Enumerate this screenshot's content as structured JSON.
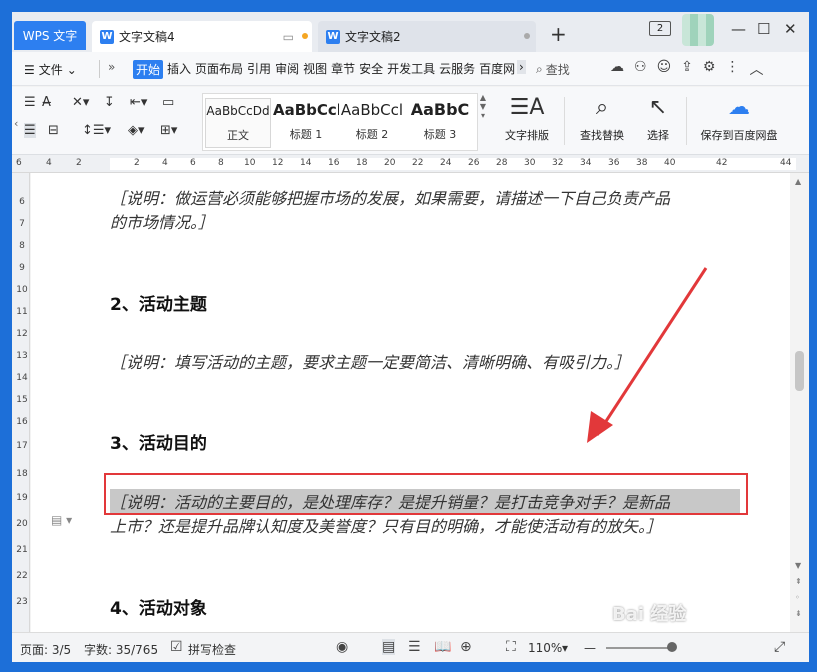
{
  "titlebar": {
    "app_tab": "WPS 文字",
    "tabs": [
      {
        "label": "文字文稿4",
        "active": true
      },
      {
        "label": "文字文稿2",
        "active": false
      }
    ],
    "window_count": "2"
  },
  "menubar": {
    "file_label": "文件",
    "more": "»",
    "items": [
      "开始",
      "插入",
      "页面布局",
      "引用",
      "审阅",
      "视图",
      "章节",
      "安全",
      "开发工具",
      "云服务",
      "百度网"
    ],
    "search_label": "查找"
  },
  "ribbon": {
    "styles": [
      {
        "preview": "AaBbCcDd",
        "name": "正文"
      },
      {
        "preview": "AaBbCcl",
        "name": "标题 1"
      },
      {
        "preview": "AaBbCcl",
        "name": "标题 2"
      },
      {
        "preview": "AaBbC",
        "name": "标题 3"
      }
    ],
    "text_layout": "文字排版",
    "find_replace": "查找替换",
    "select": "选择",
    "save_baidu": "保存到百度网盘"
  },
  "ruler": {
    "ticks": [
      "6",
      "4",
      "2",
      "",
      "2",
      "4",
      "6",
      "8",
      "10",
      "12",
      "14",
      "16",
      "18",
      "20",
      "22",
      "24",
      "26",
      "28",
      "30",
      "32",
      "34",
      "36",
      "38",
      "40",
      "42",
      "44"
    ]
  },
  "vruler": {
    "numbers": [
      "6",
      "7",
      "8",
      "9",
      "10",
      "11",
      "12",
      "13",
      "14",
      "15",
      "16",
      "17",
      "18",
      "19",
      "20",
      "21",
      "22",
      "23"
    ]
  },
  "document": {
    "note1_line1": "［说明：做运营必须能够把握市场的发展，如果需要，请描述一下自己负责产品",
    "note1_line2": "的市场情况。］",
    "heading2": "2、活动主题",
    "note2": "［说明：填写活动的主题，要求主题一定要简洁、清晰明确、有吸引力。］",
    "heading3": "3、活动目的",
    "note3_line1": "［说明：活动的主要目的，是处理库存？是提升销量？是打击竞争对手？是新品",
    "note3_line2": "上市？还是提升品牌认知度及美誉度？只有目的明确，才能使活动有的放矢。］",
    "heading4": "4、活动对象"
  },
  "statusbar": {
    "page": "页面: 3/5",
    "words": "字数: 35/765",
    "spellcheck": "拼写检查",
    "zoom": "110%"
  },
  "watermark": "Bai 经验"
}
